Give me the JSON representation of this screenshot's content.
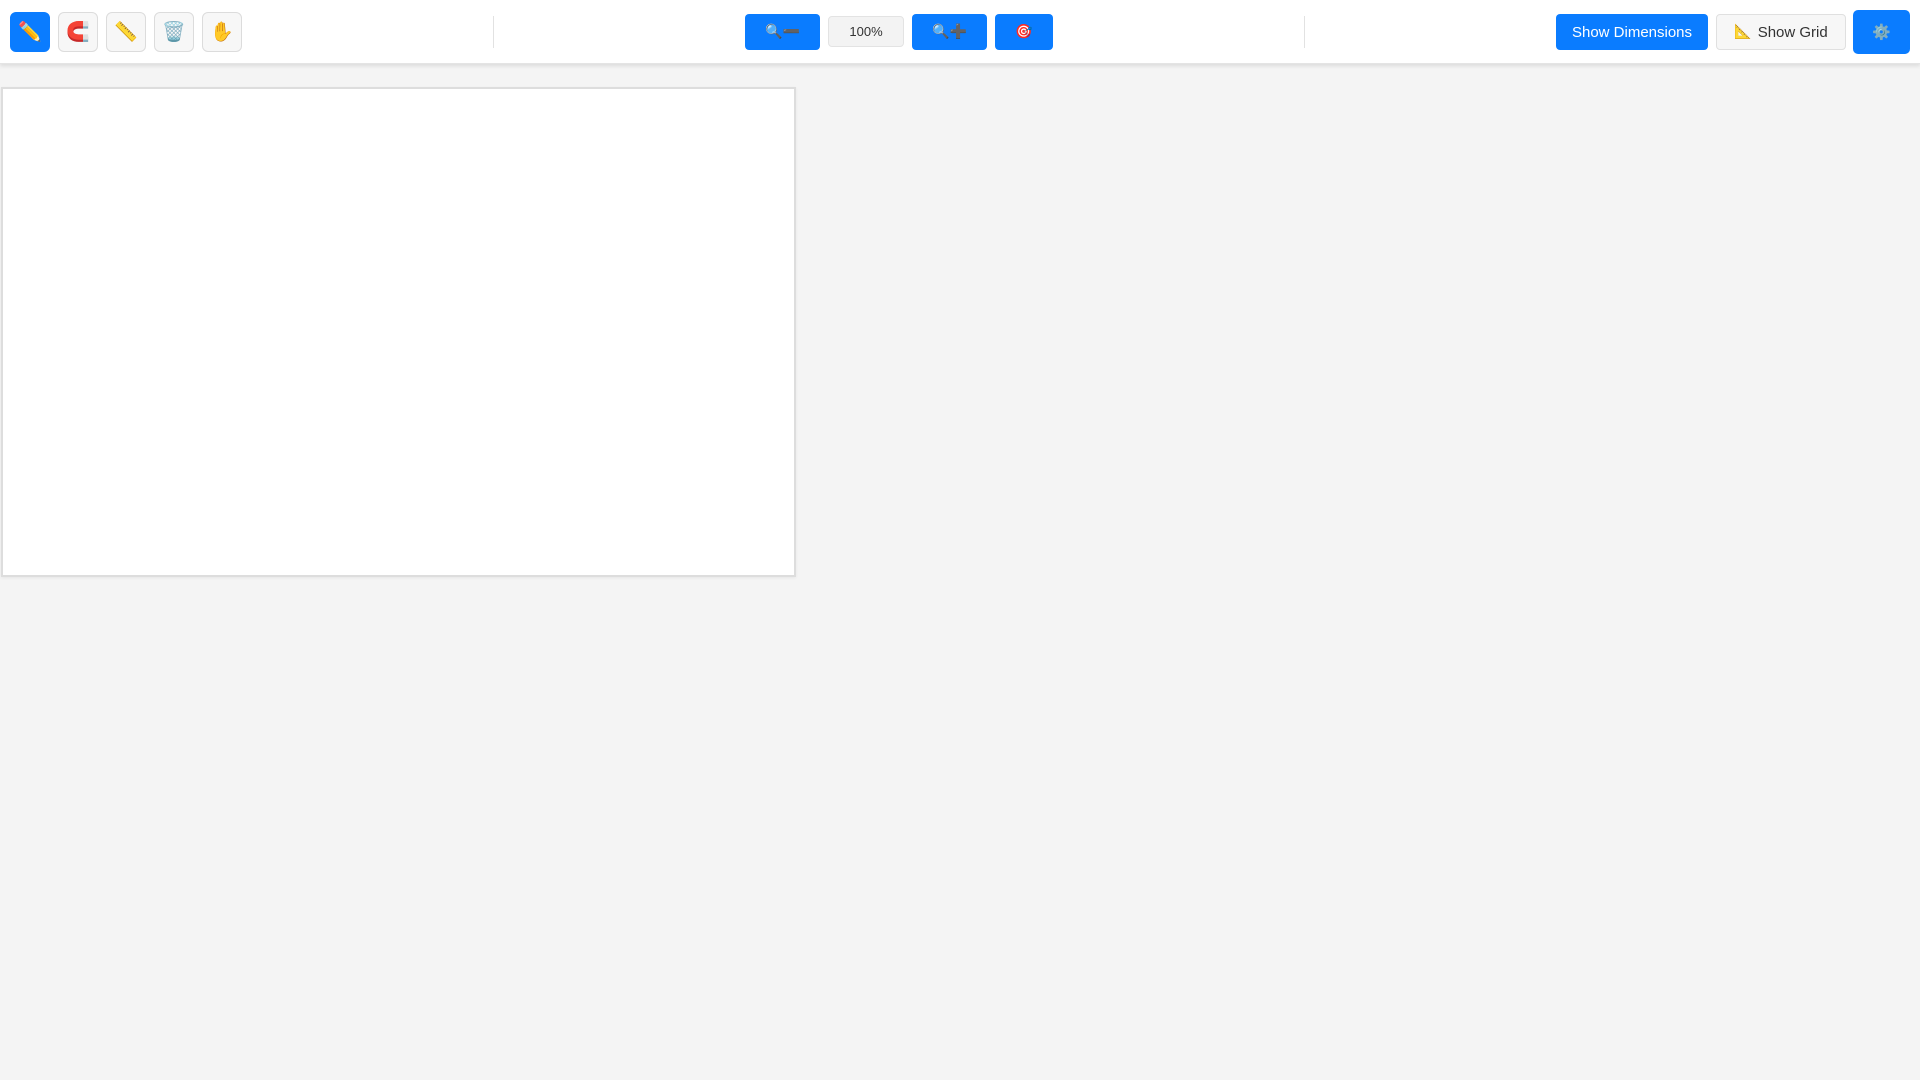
{
  "toolbar": {
    "tools": [
      {
        "name": "pencil-icon",
        "glyph": "✏️"
      },
      {
        "name": "magnet-icon",
        "glyph": "🧲"
      },
      {
        "name": "ruler-icon",
        "glyph": "📏"
      },
      {
        "name": "trash-icon",
        "glyph": "🗑️"
      },
      {
        "name": "hand-icon",
        "glyph": "✋"
      }
    ],
    "zoom": {
      "zoom_out_label": "🔍➖",
      "level": "100%",
      "zoom_in_label": "🔍➕",
      "center_label": "🎯"
    },
    "show_dimensions_label": "Show Dimensions",
    "show_grid_icon": "📐",
    "show_grid_label": "Show Grid",
    "settings_icon": "⚙️"
  },
  "colors": {
    "accent": "#0a7cff",
    "page_background": "#f4f4f4",
    "canvas_background": "#ffffff"
  }
}
